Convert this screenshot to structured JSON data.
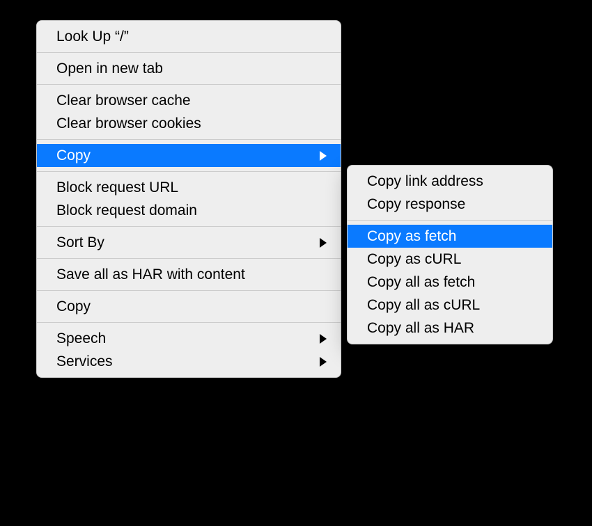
{
  "mainMenu": {
    "items": {
      "lookUp": "Look Up “/”",
      "openInNewTab": "Open in new tab",
      "clearCache": "Clear browser cache",
      "clearCookies": "Clear browser cookies",
      "copy": "Copy",
      "blockRequestUrl": "Block request URL",
      "blockRequestDomain": "Block request domain",
      "sortBy": "Sort By",
      "saveHar": "Save all as HAR with content",
      "copyPlain": "Copy",
      "speech": "Speech",
      "services": "Services"
    }
  },
  "subMenu": {
    "items": {
      "copyLinkAddress": "Copy link address",
      "copyResponse": "Copy response",
      "copyAsFetch": "Copy as fetch",
      "copyAsCurl": "Copy as cURL",
      "copyAllAsFetch": "Copy all as fetch",
      "copyAllAsCurl": "Copy all as cURL",
      "copyAllAsHar": "Copy all as HAR"
    }
  }
}
